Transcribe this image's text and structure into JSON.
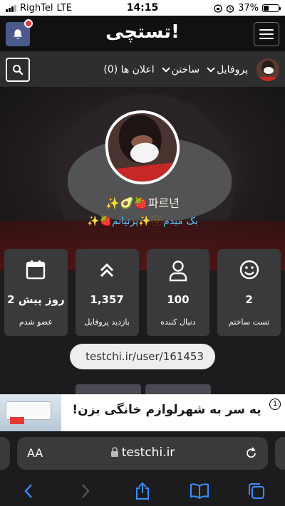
{
  "status_bar": {
    "carrier": "RighTel",
    "network": "LTE",
    "time": "14:15",
    "battery": "37%",
    "battery_level": 0.37
  },
  "header": {
    "logo": "تستچی!",
    "notification_badge_color": "#e53935"
  },
  "nav": {
    "profile_label": "پروفایل",
    "create_label": "ساختن",
    "notifications_label": "اعلان ها (0)"
  },
  "profile": {
    "name": "✨🥑🍓파르년",
    "bio": "بک میدم🫥✨پرنیانم🍓✨"
  },
  "stats": [
    {
      "icon": "smiley-icon",
      "value": "2",
      "label": "تست ساختم"
    },
    {
      "icon": "user-icon",
      "value": "100",
      "label": "دنبال کننده"
    },
    {
      "icon": "double-chevron-up-icon",
      "value": "1,357",
      "label": "بازدید پروفایل"
    },
    {
      "icon": "calendar-icon",
      "value": "2 روز پیش",
      "label": "عضو شدم"
    }
  ],
  "profile_url": "testchi.ir/user/161453",
  "ad": {
    "text": "یه سر به شهرلوازم خانگی بزن!",
    "badge": "1"
  },
  "safari": {
    "text_size_label": "AA",
    "url": "testchi.ir"
  },
  "colors": {
    "accent_blue": "#5ec8ff",
    "bell_button": "#4a5a8c",
    "card_bg": "#3a3a3c"
  }
}
